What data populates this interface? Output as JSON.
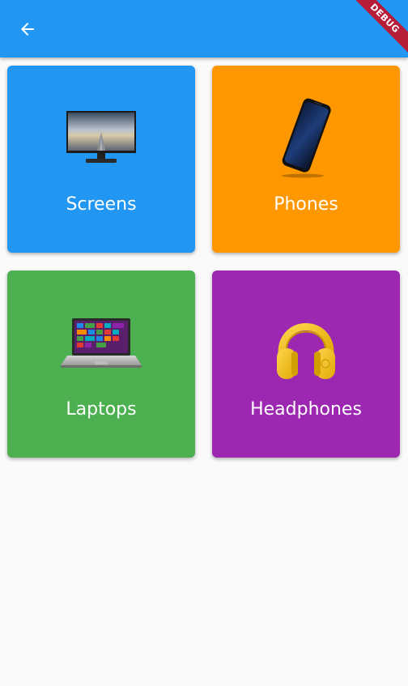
{
  "app_bar": {
    "back_icon": "arrow-back-icon",
    "color": "#2196f3"
  },
  "debug_banner": {
    "label": "DEBUG",
    "color": "#b71c39"
  },
  "categories": [
    {
      "label": "Screens",
      "icon": "monitor-image",
      "color": "#2196f3"
    },
    {
      "label": "Phones",
      "icon": "smartphone-image",
      "color": "#ff9800"
    },
    {
      "label": "Laptops",
      "icon": "laptop-image",
      "color": "#4caf50"
    },
    {
      "label": "Headphones",
      "icon": "headphones-image",
      "color": "#9c27b0"
    }
  ]
}
